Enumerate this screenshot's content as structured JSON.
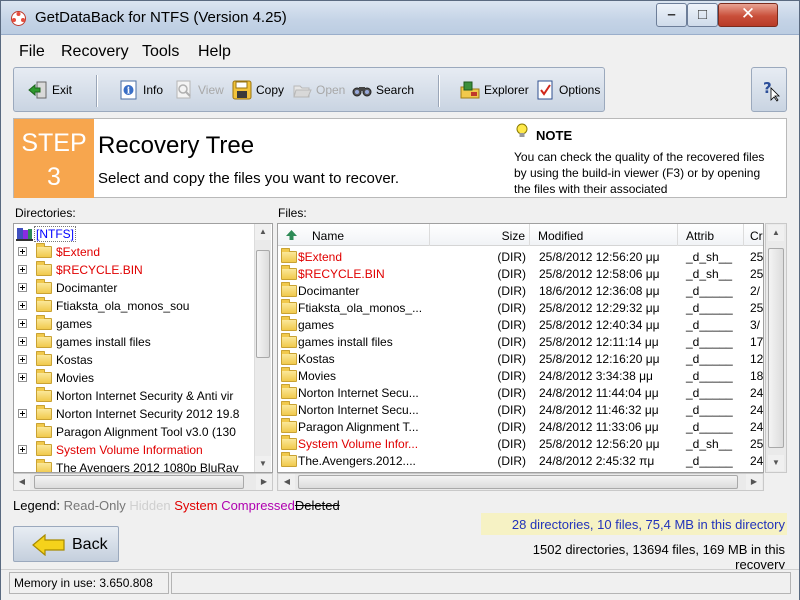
{
  "window": {
    "title": "GetDataBack for NTFS (Version 4.25)"
  },
  "menu": [
    {
      "label": "File"
    },
    {
      "label": "Recovery"
    },
    {
      "label": "Tools"
    },
    {
      "label": "Help"
    }
  ],
  "toolbar": {
    "exit": "Exit",
    "info": "Info",
    "view": "View",
    "copy": "Copy",
    "open": "Open",
    "search": "Search",
    "explorer": "Explorer",
    "options": "Options"
  },
  "step": {
    "word": "STEP",
    "number": "3",
    "title": "Recovery Tree",
    "subtitle": "Select and copy the files you want to recover."
  },
  "note": {
    "heading": "NOTE",
    "body": "You can check the quality of the recovered files by using the build-in viewer (F3) or by opening the files with their associated"
  },
  "directories": {
    "label": "Directories:",
    "root": "[NTFS]",
    "items": [
      {
        "name": "$Extend",
        "system": true,
        "expandable": true
      },
      {
        "name": "$RECYCLE.BIN",
        "system": true,
        "expandable": true
      },
      {
        "name": "Docimanter",
        "system": false,
        "expandable": true
      },
      {
        "name": "Ftiaksta_ola_monos_sou",
        "system": false,
        "expandable": true
      },
      {
        "name": "games",
        "system": false,
        "expandable": true
      },
      {
        "name": "games install files",
        "system": false,
        "expandable": true
      },
      {
        "name": "Kostas",
        "system": false,
        "expandable": true
      },
      {
        "name": "Movies",
        "system": false,
        "expandable": true
      },
      {
        "name": "Norton Internet Security & Anti vir",
        "system": false,
        "expandable": false
      },
      {
        "name": "Norton Internet Security 2012 19.8",
        "system": false,
        "expandable": true
      },
      {
        "name": "Paragon Alignment Tool v3.0 (130",
        "system": false,
        "expandable": false
      },
      {
        "name": "System Volume Information",
        "system": true,
        "expandable": true
      },
      {
        "name": "The Avengers 2012 1080p BluRay",
        "system": false,
        "expandable": false
      }
    ]
  },
  "files": {
    "label": "Files:",
    "columns": [
      "Name",
      "Size",
      "Modified",
      "Attrib",
      "Cr"
    ],
    "rows": [
      {
        "name": "$Extend",
        "size": "(DIR)",
        "modified": "25/8/2012 12:56:20 μμ",
        "attrib": "_d_sh__",
        "cr": "25",
        "system": true
      },
      {
        "name": "$RECYCLE.BIN",
        "size": "(DIR)",
        "modified": "25/8/2012 12:58:06 μμ",
        "attrib": "_d_sh__",
        "cr": "25",
        "system": true
      },
      {
        "name": "Docimanter",
        "size": "(DIR)",
        "modified": "18/6/2012 12:36:08 μμ",
        "attrib": "_d_____",
        "cr": "2/",
        "system": false
      },
      {
        "name": "Ftiaksta_ola_monos_...",
        "size": "(DIR)",
        "modified": "25/8/2012 12:29:32 μμ",
        "attrib": "_d_____",
        "cr": "25",
        "system": false
      },
      {
        "name": "games",
        "size": "(DIR)",
        "modified": "25/8/2012 12:40:34 μμ",
        "attrib": "_d_____",
        "cr": "3/",
        "system": false
      },
      {
        "name": "games install files",
        "size": "(DIR)",
        "modified": "25/8/2012 12:11:14 μμ",
        "attrib": "_d_____",
        "cr": "17",
        "system": false
      },
      {
        "name": "Kostas",
        "size": "(DIR)",
        "modified": "25/8/2012 12:16:20 μμ",
        "attrib": "_d_____",
        "cr": "12",
        "system": false
      },
      {
        "name": "Movies",
        "size": "(DIR)",
        "modified": "24/8/2012 3:34:38 μμ",
        "attrib": "_d_____",
        "cr": "18",
        "system": false
      },
      {
        "name": "Norton Internet Secu...",
        "size": "(DIR)",
        "modified": "24/8/2012 11:44:04 μμ",
        "attrib": "_d_____",
        "cr": "24",
        "system": false
      },
      {
        "name": "Norton Internet Secu...",
        "size": "(DIR)",
        "modified": "24/8/2012 11:46:32 μμ",
        "attrib": "_d_____",
        "cr": "24",
        "system": false
      },
      {
        "name": "Paragon Alignment T...",
        "size": "(DIR)",
        "modified": "24/8/2012 11:33:06 μμ",
        "attrib": "_d_____",
        "cr": "24",
        "system": false
      },
      {
        "name": "System Volume Infor...",
        "size": "(DIR)",
        "modified": "25/8/2012 12:56:20 μμ",
        "attrib": "_d_sh__",
        "cr": "25",
        "system": true
      },
      {
        "name": "The.Avengers.2012....",
        "size": "(DIR)",
        "modified": "24/8/2012 2:45:32 πμ",
        "attrib": "_d_____",
        "cr": "24",
        "system": false
      }
    ]
  },
  "legend": {
    "label": "Legend:",
    "readonly": "Read-Only",
    "hidden": "Hidden",
    "system": "System",
    "compressed": "Compressed",
    "deleted": "Deleted"
  },
  "back_label": "Back",
  "stats": {
    "directory": "28 directories, 10 files, 75,4 MB in this directory",
    "recovery": "1502 directories, 13694 files, 169 MB in this recovery"
  },
  "status": {
    "memory": "Memory in use: 3.650.808"
  },
  "colors": {
    "step_accent": "#f7a64e",
    "system_text": "#e00000",
    "root_highlight": "#0000ff",
    "compressed_text": "#b000b0",
    "stat_highlight": "#f6f2c4",
    "stat_text": "#2233bb"
  }
}
